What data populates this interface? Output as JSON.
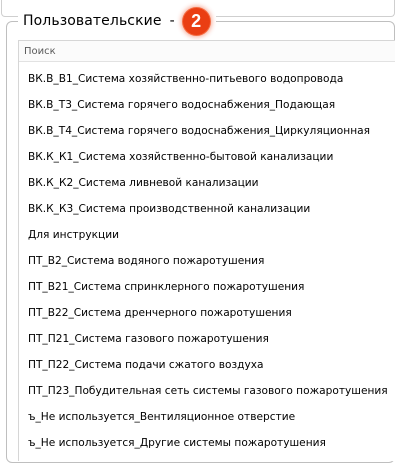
{
  "group": {
    "title": "Пользовательские",
    "dash": "-",
    "badge": "2"
  },
  "search": {
    "placeholder": "Поиск",
    "value": ""
  },
  "items": [
    "ВК.В_В1_Система хозяйственно-питьевого водопровода",
    "ВК.В_Т3_Система горячего водоснабжения_Подающая",
    "ВК.В_Т4_Система горячего водоснабжения_Циркуляционная",
    "ВК.К_К1_Система хозяйственно-бытовой канализации",
    "ВК.К_К2_Система ливневой канализации",
    "ВК.К_К3_Система производственной канализации",
    "Для инструкции",
    "ПТ_В2_Система водяного пожаротушения",
    "ПТ_В21_Система спринклерного пожаротушения",
    "ПТ_В22_Система дренчерного пожаротушения",
    "ПТ_П21_Система газового пожаротушения",
    "ПТ_П22_Система подачи сжатого воздуха",
    "ПТ_П23_Побудительная сеть системы газового пожаротушения",
    "ъ_Не используется_Вентиляционное отверстие",
    "ъ_Не используется_Другие системы пожаротушения"
  ]
}
